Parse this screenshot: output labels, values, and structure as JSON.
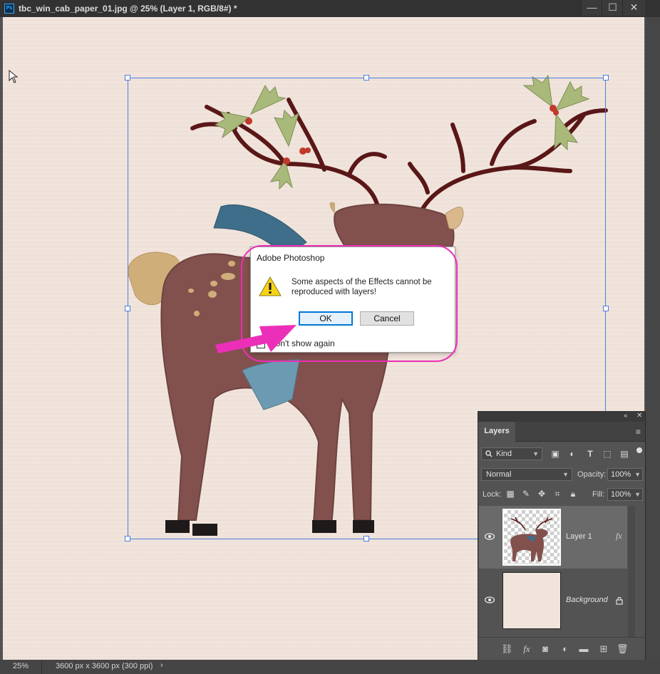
{
  "window": {
    "title": "tbc_win_cab_paper_01.jpg @ 25% (Layer 1, RGB/8#) *",
    "app_icon": "Ps",
    "minimize": "—",
    "maximize": "☐",
    "close": "✕"
  },
  "status": {
    "zoom": "25%",
    "doc_size": "3600 px x 3600 px (300 ppi)",
    "arrow": "›"
  },
  "dialog": {
    "title": "Adobe Photoshop",
    "icon": "warning-icon",
    "message": "Some aspects of the Effects cannot be reproduced with layers!",
    "ok_label": "OK",
    "cancel_label": "Cancel",
    "checkbox_label": "Don't show again",
    "checkbox_checked": false
  },
  "annotation": {
    "color": "#ec2fb8"
  },
  "layers_panel": {
    "collapse": "«",
    "close": "✕",
    "tab_label": "Layers",
    "menu_icon": "≡",
    "filter_kind": "Kind",
    "blend_mode": "Normal",
    "opacity_label": "Opacity:",
    "opacity_value": "100%",
    "lock_label": "Lock:",
    "fill_label": "Fill:",
    "fill_value": "100%",
    "layers": [
      {
        "name": "Layer 1",
        "visible": true,
        "has_fx": true,
        "fx_label": "fx",
        "selected": true
      },
      {
        "name": "Background",
        "visible": true,
        "locked": true,
        "selected": false
      }
    ],
    "footer_icons": [
      "link-icon",
      "fx-icon",
      "mask-icon",
      "adjustment-icon",
      "folder-icon",
      "new-layer-icon",
      "trash-icon"
    ]
  },
  "colors": {
    "selection_box": "#4a7de0",
    "paper": "#f1e4dc",
    "accent_pink": "#ec2fb8"
  }
}
